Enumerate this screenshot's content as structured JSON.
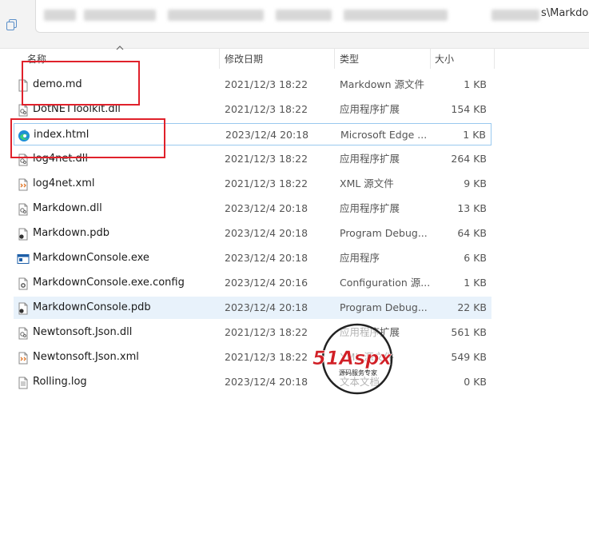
{
  "address": {
    "path_tail": "s\\Markdow"
  },
  "columns": {
    "name": "名称",
    "date": "修改日期",
    "type": "类型",
    "size": "大小"
  },
  "files": [
    {
      "name": "demo.md",
      "date": "2021/12/3 18:22",
      "type": "Markdown 源文件",
      "size": "1 KB",
      "icon": "file-generic-icon"
    },
    {
      "name": "DotNETToolkit.dll",
      "date": "2021/12/3 18:22",
      "type": "应用程序扩展",
      "size": "154 KB",
      "icon": "file-dll-icon"
    },
    {
      "name": "index.html",
      "date": "2023/12/4 20:18",
      "type": "Microsoft Edge ...",
      "size": "1 KB",
      "icon": "edge-icon"
    },
    {
      "name": "log4net.dll",
      "date": "2021/12/3 18:22",
      "type": "应用程序扩展",
      "size": "264 KB",
      "icon": "file-dll-icon"
    },
    {
      "name": "log4net.xml",
      "date": "2021/12/3 18:22",
      "type": "XML 源文件",
      "size": "9 KB",
      "icon": "file-xml-icon"
    },
    {
      "name": "Markdown.dll",
      "date": "2023/12/4 20:18",
      "type": "应用程序扩展",
      "size": "13 KB",
      "icon": "file-dll-icon"
    },
    {
      "name": "Markdown.pdb",
      "date": "2023/12/4 20:18",
      "type": "Program Debug...",
      "size": "64 KB",
      "icon": "file-pdb-icon"
    },
    {
      "name": "MarkdownConsole.exe",
      "date": "2023/12/4 20:18",
      "type": "应用程序",
      "size": "6 KB",
      "icon": "file-exe-icon"
    },
    {
      "name": "MarkdownConsole.exe.config",
      "date": "2023/12/4 20:16",
      "type": "Configuration 源...",
      "size": "1 KB",
      "icon": "file-config-icon"
    },
    {
      "name": "MarkdownConsole.pdb",
      "date": "2023/12/4 20:18",
      "type": "Program Debug...",
      "size": "22 KB",
      "icon": "file-pdb-icon"
    },
    {
      "name": "Newtonsoft.Json.dll",
      "date": "2021/12/3 18:22",
      "type": "应用程序扩展",
      "size": "561 KB",
      "icon": "file-dll-icon"
    },
    {
      "name": "Newtonsoft.Json.xml",
      "date": "2021/12/3 18:22",
      "type": "XML 源文件",
      "size": "549 KB",
      "icon": "file-xml-icon"
    },
    {
      "name": "Rolling.log",
      "date": "2023/12/4 20:18",
      "type": "文本文档",
      "size": "0 KB",
      "icon": "file-text-icon"
    }
  ],
  "watermark": {
    "brand": "51Aspx",
    "sub": "源码服务专家"
  },
  "colors": {
    "highlight_box": "#e0212b",
    "hover_row": "#e8f2fb",
    "selected_border": "#99c9ef"
  }
}
